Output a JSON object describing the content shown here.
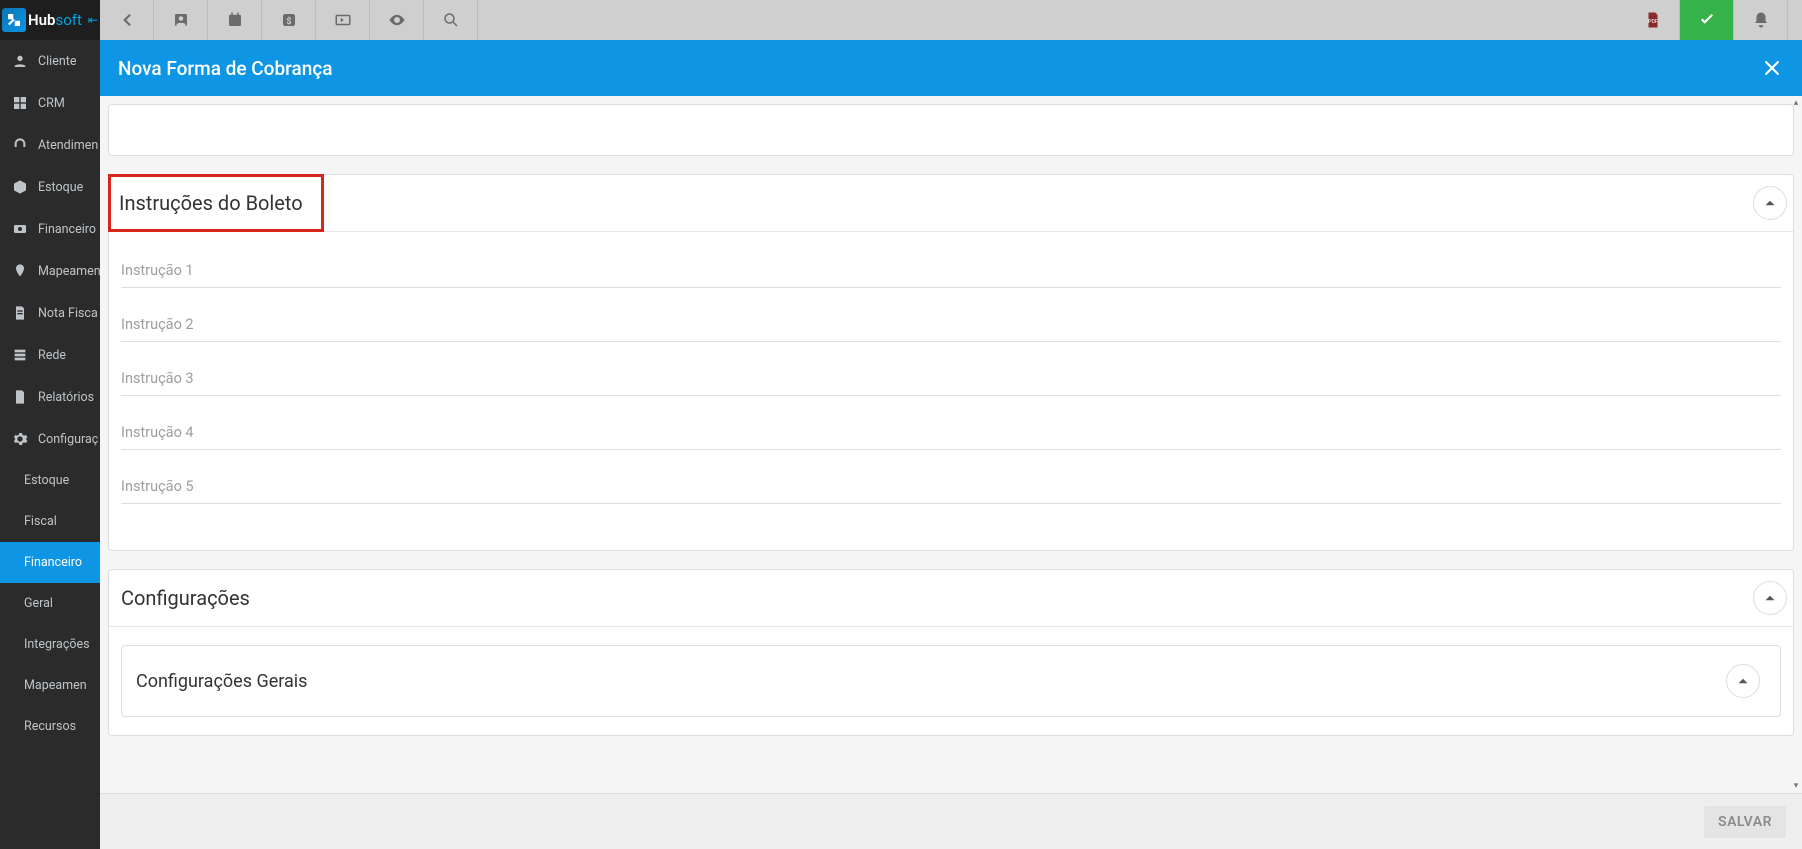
{
  "logo": {
    "brand1": "Hub",
    "brand2": "soft"
  },
  "sidebar": {
    "items": [
      {
        "label": "Cliente",
        "icon": "person"
      },
      {
        "label": "CRM",
        "icon": "dashboard"
      },
      {
        "label": "Atendimen",
        "icon": "headset"
      },
      {
        "label": "Estoque",
        "icon": "box"
      },
      {
        "label": "Financeiro",
        "icon": "money"
      },
      {
        "label": "Mapeamen",
        "icon": "map-pin"
      },
      {
        "label": "Nota Fisca",
        "icon": "file"
      },
      {
        "label": "Rede",
        "icon": "stack"
      },
      {
        "label": "Relatórios",
        "icon": "doc"
      },
      {
        "label": "Configuraç",
        "icon": "gear"
      }
    ],
    "sub_items": [
      {
        "label": "Estoque",
        "active": false
      },
      {
        "label": "Fiscal",
        "active": false
      },
      {
        "label": "Financeiro",
        "active": true
      },
      {
        "label": "Geral",
        "active": false
      },
      {
        "label": "Integrações",
        "active": false
      },
      {
        "label": "Mapeamen",
        "active": false
      },
      {
        "label": "Recursos",
        "active": false
      }
    ]
  },
  "modal": {
    "title": "Nova Forma de Cobrança",
    "sections": {
      "instrucoes": {
        "title": "Instruções do Boleto",
        "fields": [
          "Instrução 1",
          "Instrução 2",
          "Instrução 3",
          "Instrução 4",
          "Instrução 5"
        ]
      },
      "config": {
        "title": "Configurações",
        "inner_title": "Configurações Gerais"
      }
    },
    "save": "SALVAR"
  }
}
